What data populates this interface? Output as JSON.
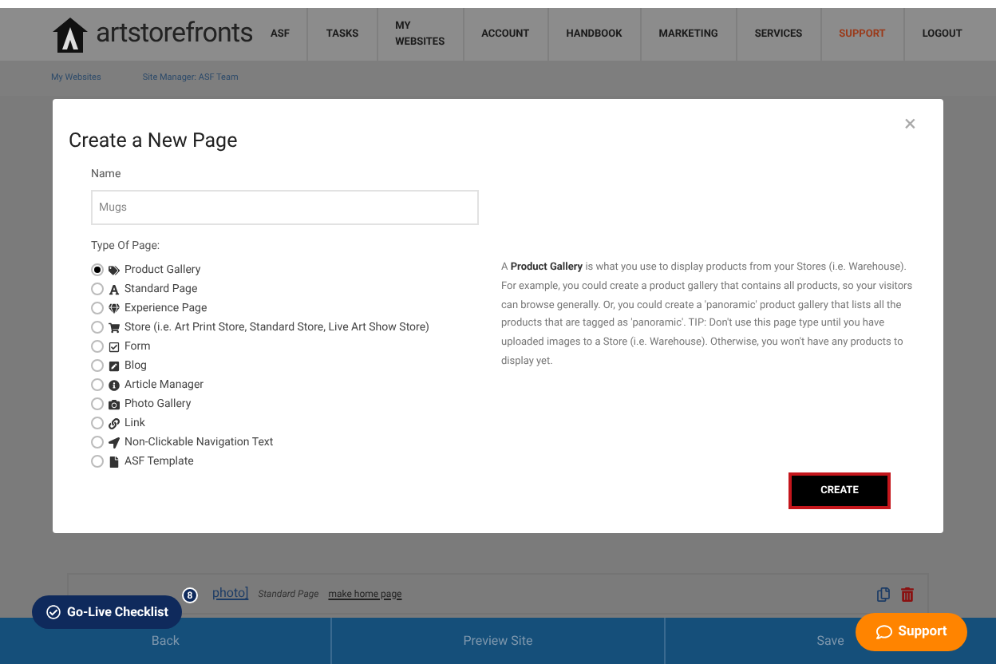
{
  "header": {
    "logo_text": "artstorefronts",
    "nav": [
      {
        "label": "ASF",
        "selected": false
      },
      {
        "label": "TASKS",
        "selected": false
      },
      {
        "label": "MY WEBSITES",
        "selected": false
      },
      {
        "label": "ACCOUNT",
        "selected": false
      },
      {
        "label": "HANDBOOK",
        "selected": false
      },
      {
        "label": "MARKETING",
        "selected": false
      },
      {
        "label": "SERVICES",
        "selected": false
      },
      {
        "label": "SUPPORT",
        "selected": true
      },
      {
        "label": "LOGOUT",
        "selected": false
      }
    ]
  },
  "breadcrumb": [
    "My Websites",
    "Site Manager: ASF Team"
  ],
  "dialog": {
    "title": "Create a New Page",
    "name_label": "Name",
    "name_value": "Mugs",
    "type_label": "Type Of Page:",
    "types": [
      {
        "label": "Product Gallery",
        "selected": true
      },
      {
        "label": "Standard Page",
        "selected": false
      },
      {
        "label": "Experience Page",
        "selected": false
      },
      {
        "label": "Store (i.e. Art Print Store, Standard Store, Live Art Show Store)",
        "selected": false
      },
      {
        "label": "Form",
        "selected": false
      },
      {
        "label": "Blog",
        "selected": false
      },
      {
        "label": "Article Manager",
        "selected": false
      },
      {
        "label": "Photo Gallery",
        "selected": false
      },
      {
        "label": "Link",
        "selected": false
      },
      {
        "label": "Non-Clickable Navigation Text",
        "selected": false
      },
      {
        "label": "ASF Template",
        "selected": false
      }
    ],
    "description": "A **Product Gallery** is what you use to display products from your Stores (i.e. Warehouse). For example, you could create a product gallery that contains all products, so your visitors can browse generally. Or, you could create a 'panoramic' product gallery that lists all the products that are tagged as 'panoramic'. TIP: Don't use this page type until you have uploaded images to a Store (i.e. Warehouse). Otherwise, you won't have any products to display yet.",
    "close": "×",
    "create_button": "CREATE"
  },
  "page_row": {
    "link": "photo]",
    "type": "Standard Page",
    "action": "make home page"
  },
  "checklist": {
    "label": "Go-Live Checklist",
    "count": "8"
  },
  "footer": [
    "Back",
    "Preview Site",
    "Save"
  ],
  "support_button": "Support"
}
